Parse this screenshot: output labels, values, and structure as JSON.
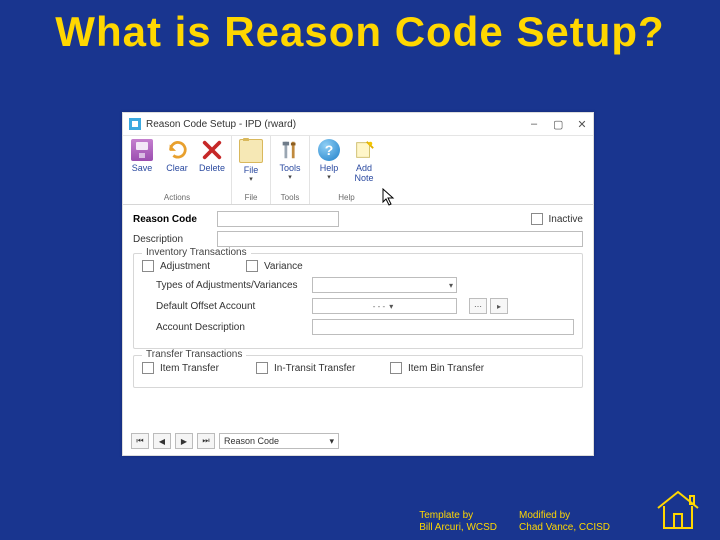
{
  "slide": {
    "title": "What is Reason Code Setup?"
  },
  "window": {
    "title": "Reason Code Setup  -  IPD (rward)",
    "controls": {
      "min": "–",
      "max": "▢",
      "close": "✕"
    }
  },
  "ribbon": {
    "groups": [
      {
        "label": "Actions",
        "buttons": [
          {
            "id": "save",
            "label": "Save"
          },
          {
            "id": "clear",
            "label": "Clear"
          },
          {
            "id": "delete",
            "label": "Delete"
          }
        ]
      },
      {
        "label": "File",
        "buttons": [
          {
            "id": "file",
            "label": "File",
            "dropdown": true
          }
        ]
      },
      {
        "label": "Tools",
        "buttons": [
          {
            "id": "tools",
            "label": "Tools",
            "dropdown": true
          }
        ]
      },
      {
        "label": "Help",
        "buttons": [
          {
            "id": "help",
            "label": "Help",
            "dropdown": true
          },
          {
            "id": "addnote",
            "label": "Add\nNote"
          }
        ]
      }
    ]
  },
  "form": {
    "reason_code_label": "Reason Code",
    "reason_code_value": "",
    "inactive_label": "Inactive",
    "description_label": "Description",
    "description_value": ""
  },
  "inventory": {
    "legend": "Inventory Transactions",
    "adjustment_label": "Adjustment",
    "variance_label": "Variance",
    "types_label": "Types of Adjustments/Variances",
    "types_value": "",
    "offset_label": "Default Offset Account",
    "offset_value": "-    -    -",
    "acctdesc_label": "Account Description",
    "acctdesc_value": ""
  },
  "transfer": {
    "legend": "Transfer Transactions",
    "item_transfer_label": "Item Transfer",
    "intransit_label": "In-Transit Transfer",
    "item_bin_label": "Item Bin Transfer"
  },
  "nav": {
    "by_label": "Reason Code"
  },
  "credits": {
    "left": {
      "h": "Template by",
      "n": "Bill Arcuri, WCSD"
    },
    "right": {
      "h": "Modified by",
      "n": "Chad Vance, CCISD"
    }
  }
}
